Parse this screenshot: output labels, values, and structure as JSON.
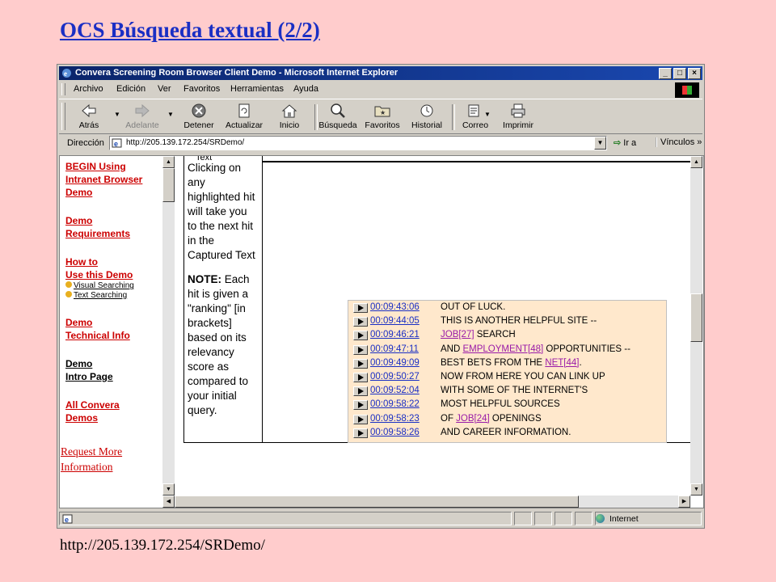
{
  "slide": {
    "title": "OCS Búsqueda textual (2/2)",
    "footer_url": "http://205.139.172.254/SRDemo/"
  },
  "window": {
    "title": "Convera Screening Room Browser Client Demo - Microsoft Internet Explorer",
    "buttons": {
      "minimize": "_",
      "maximize": "□",
      "close": "×"
    }
  },
  "menu": {
    "items": [
      "Archivo",
      "Edición",
      "Ver",
      "Favoritos",
      "Herramientas",
      "Ayuda"
    ]
  },
  "toolbar": {
    "back": "Atrás",
    "forward": "Adelante",
    "stop": "Detener",
    "refresh": "Actualizar",
    "home": "Inicio",
    "search": "Búsqueda",
    "favorites": "Favoritos",
    "history": "Historial",
    "mail": "Correo",
    "print": "Imprimir"
  },
  "address": {
    "label": "Dirección",
    "url": "http://205.139.172.254/SRDemo/",
    "go": "Ir a",
    "links": "Vínculos"
  },
  "nav": {
    "begin": [
      "BEGIN Using",
      "Intranet Browser",
      "Demo"
    ],
    "requirements": [
      "Demo",
      "Requirements"
    ],
    "howto": [
      "How to",
      "Use this Demo"
    ],
    "visual": "Visual Searching",
    "text": "Text Searching",
    "technical": [
      "Demo",
      "Technical Info"
    ],
    "intro": [
      "Demo",
      "Intro Page"
    ],
    "convera": [
      "All Convera",
      "Demos"
    ],
    "request": [
      "Request More",
      "Information"
    ]
  },
  "info": {
    "cut": "Text",
    "line1": "Clicking on any highlighted hit will take you to the next hit in the Captured Text",
    "note_label": "NOTE:",
    "note_text": " Each hit is given a \"ranking\" [in brackets] based on its relevancy score as compared to your initial query."
  },
  "hits": [
    {
      "time": "00:09:43:06",
      "pre": "OUT OF LUCK.",
      "kw": "",
      "post": ""
    },
    {
      "time": "00:09:44:05",
      "pre": "THIS IS ANOTHER HELPFUL SITE --",
      "kw": "",
      "post": ""
    },
    {
      "time": "00:09:46:21",
      "pre": "",
      "kw": "JOB[27]",
      "post": " SEARCH"
    },
    {
      "time": "00:09:47:11",
      "pre": "AND ",
      "kw": "EMPLOYMENT[48]",
      "post": " OPPORTUNITIES --"
    },
    {
      "time": "00:09:49:09",
      "pre": "BEST BETS FROM THE ",
      "kw": "NET[44]",
      "post": "."
    },
    {
      "time": "00:09:50:27",
      "pre": "NOW FROM HERE YOU CAN LINK UP",
      "kw": "",
      "post": ""
    },
    {
      "time": "00:09:52:04",
      "pre": "WITH SOME OF THE INTERNET'S",
      "kw": "",
      "post": ""
    },
    {
      "time": "00:09:58:22",
      "pre": "MOST HELPFUL SOURCES",
      "kw": "",
      "post": ""
    },
    {
      "time": "00:09:58:23",
      "pre": "OF ",
      "kw": "JOB[24]",
      "post": " OPENINGS"
    },
    {
      "time": "00:09:58:26",
      "pre": "AND CAREER INFORMATION.",
      "kw": "",
      "post": ""
    }
  ],
  "status": {
    "zone": "Internet"
  }
}
